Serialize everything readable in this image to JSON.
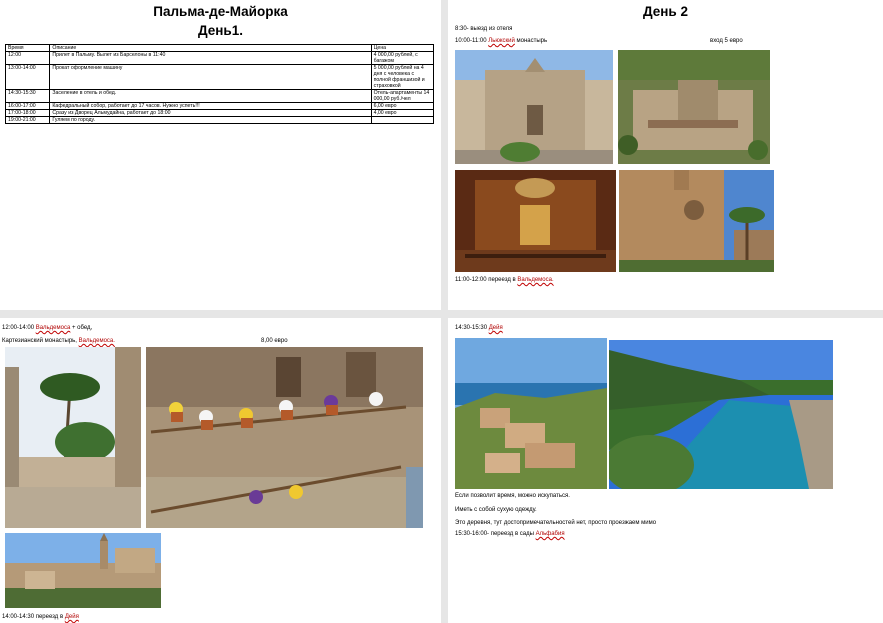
{
  "page1": {
    "title": "Пальма-де-Майорка",
    "subtitle": "День1.",
    "table": {
      "headers": [
        "Время",
        "Описание",
        "Цена"
      ],
      "rows": [
        {
          "time": "12:00",
          "desc": "Прилет в Пальму. Вылет из Барселоны в 11:40",
          "price": "4 000,00 рублей, с багажом"
        },
        {
          "time": "13:00-14:00",
          "desc": "Прокат оформление машину",
          "price": "5 000,00 рублей на 4 дня с человека с полной франшизой и страховкой"
        },
        {
          "time": "14:30-15:30",
          "desc": "Заселение в отель и обед.",
          "price": "Отель-апартаменты 14 000,00 руб./чел"
        },
        {
          "time": "16:00-17:00",
          "desc": "Кафедральный собор, работает до 17 часов. Нужно успеть!!!",
          "price": "6,00 евро"
        },
        {
          "time": "17:00-18:00",
          "desc": "Сразу из Дворец Альмудайна, работает до 18:00",
          "price": "4,00 евро"
        },
        {
          "time": "19:00-21:00",
          "desc": "Гуляем по городу.",
          "price": ""
        }
      ]
    }
  },
  "page2": {
    "title": "День 2",
    "line1": "8:30- выезд из отеля",
    "line2_pre": "10:00-11:00 ",
    "line2_red": "Льюкский",
    "line2_post": " монастырь",
    "entrance": "вход 5 евро",
    "bottom_pre": "11:00-12:00 переезд в ",
    "bottom_red": "Вальдемоса."
  },
  "page3": {
    "line1_pre": "12:00-14:00 ",
    "line1_red": "Вальдемоса",
    "line1_post": " + обед,",
    "line2_pre": "Картезианский монастырь, ",
    "line2_red": "Вальдемоса.",
    "price": "8,00 евро",
    "bottom_pre": "14:00-14:30 переезд в ",
    "bottom_red": "Дейя"
  },
  "page4": {
    "line1_pre": "14:30-15:30 ",
    "line1_red": "Дейя",
    "note1": "Если позволит время, можно искупаться.",
    "note2": "Иметь с собой сухую одежду.",
    "note3": "Это деревня, тут достопримечательностей нет, просто проезжаем мимо",
    "last_pre": "15:30-16:00- переезд в сады ",
    "last_red": "Альфабия"
  }
}
